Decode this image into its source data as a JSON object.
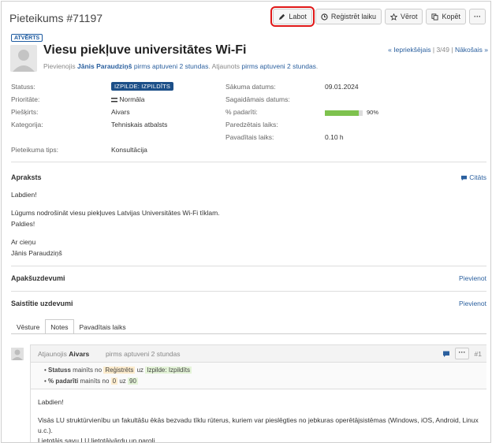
{
  "page": {
    "title": "Pieteikums #71197"
  },
  "toolbar": {
    "edit": "Labot",
    "log_time": "Reģistrēt laiku",
    "watch": "Vērot",
    "copy": "Kopēt",
    "more": "···"
  },
  "issue": {
    "status_badge": "ATVĒRTS",
    "subject": "Viesu piekļuve universitātes Wi-Fi",
    "added_by_prefix": "Pievienojis",
    "author": "Jānis Paraudziņš",
    "added_ago": "pirms aptuveni 2 stundas",
    "updated_prefix": ". Atjaunots",
    "updated_ago": "pirms aptuveni 2 stundas",
    "nav_prev": "« Iepriekšējais",
    "nav_pos": "3/49",
    "nav_next": "Nākošais »"
  },
  "attributes": {
    "status_label": "Statuss:",
    "status_value": "IZPILDE: IZPILDĪTS",
    "priority_label": "Prioritāte:",
    "priority_value": "Normāla",
    "assignee_label": "Piešķirts:",
    "assignee_value": "Aivars",
    "category_label": "Kategorija:",
    "category_value": "Tehniskais atbalsts",
    "type_label": "Pieteikuma tips:",
    "type_value": "Konsultācija",
    "start_label": "Sākuma datums:",
    "start_value": "09.01.2024",
    "due_label": "Sagaidāmais datums:",
    "done_label": "% padarīti:",
    "done_value": "90%",
    "done_fraction": 0.9,
    "estimated_label": "Paredzētais laiks:",
    "spent_label": "Pavadītais laiks:",
    "spent_value": "0.10 h"
  },
  "description": {
    "title": "Apraksts",
    "quote": "Citāts",
    "line1": "Labdien!",
    "line2": "Lūgums nodrošināt viesu piekļuves Latvijas Universitātes Wi-Fi tīklam.",
    "line3": "Paldies!",
    "line4": "Ar cieņu",
    "line5": "Jānis Paraudziņš"
  },
  "subtasks": {
    "title": "Apakšuzdevumi",
    "add": "Pievienot"
  },
  "related": {
    "title": "Saistītie uzdevumi",
    "add": "Pievienot"
  },
  "tabs": [
    "Vēsture",
    "Notes",
    "Pavadītais laiks"
  ],
  "journal": {
    "updated_by": "Atjaunojis",
    "user": "Aivars",
    "when": "pirms aptuveni 2 stundas",
    "number": "#1",
    "d1_field": "Statuss",
    "d1_changed": "mainīts no",
    "d1_old": "Reģistrēts",
    "d1_to": "uz",
    "d1_new": "Izpilde: Izpildīts",
    "d2_field": "% padarīti",
    "d2_changed": "mainīts no",
    "d2_old": "0",
    "d2_to": "uz",
    "d2_new": "90",
    "note1": "Labdien!",
    "note2": "Visās LU struktūrvienību un fakultāšu ēkās bezvadu tīklu rūterus, kuriem var pieslēgties no jebkuras operētājsistēmas (Windows, iOS, Android, Linux u.c.).",
    "note3": "Lietotājs savu LU lietotājvārdu un paroli"
  }
}
